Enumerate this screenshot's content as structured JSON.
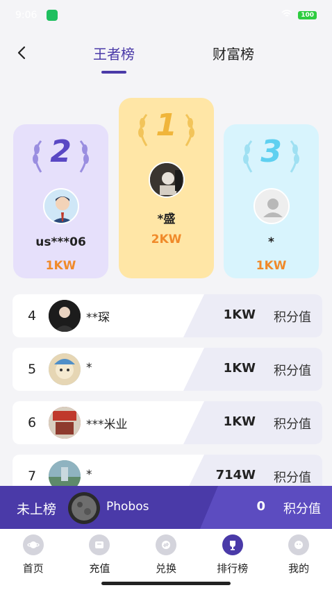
{
  "status_bar": {
    "time": "9:06",
    "battery": "100"
  },
  "header": {
    "back_label": "‹",
    "tabs": [
      {
        "label": "王者榜",
        "active": true
      },
      {
        "label": "财富榜",
        "active": false
      }
    ]
  },
  "podium": [
    {
      "rank": "2",
      "name": "us***06",
      "score": "1KW",
      "color": "#e6e0fb",
      "rank_color": "#5a48c4"
    },
    {
      "rank": "1",
      "name": "*盛",
      "score": "2KW",
      "color": "#ffe6a6",
      "rank_color": "#f0b53a"
    },
    {
      "rank": "3",
      "name": "*",
      "score": "1KW",
      "color": "#d8f4fd",
      "rank_color": "#5fd0f0"
    }
  ],
  "list": [
    {
      "rank": "4",
      "name": "**琛",
      "score": "1KW",
      "unit": "积分值"
    },
    {
      "rank": "5",
      "name": "*",
      "score": "1KW",
      "unit": "积分值"
    },
    {
      "rank": "6",
      "name": "***米业",
      "score": "1KW",
      "unit": "积分值"
    },
    {
      "rank": "7",
      "name": "*",
      "score": "714W",
      "unit": "积分值"
    }
  ],
  "my_rank": {
    "status": "未上榜",
    "name": "Phobos",
    "score": "0",
    "unit": "积分值"
  },
  "nav": [
    {
      "label": "首页",
      "icon": "planet-icon"
    },
    {
      "label": "充值",
      "icon": "wallet-icon"
    },
    {
      "label": "兑换",
      "icon": "exchange-icon"
    },
    {
      "label": "排行榜",
      "icon": "trophy-icon",
      "active": true
    },
    {
      "label": "我的",
      "icon": "user-icon"
    }
  ]
}
